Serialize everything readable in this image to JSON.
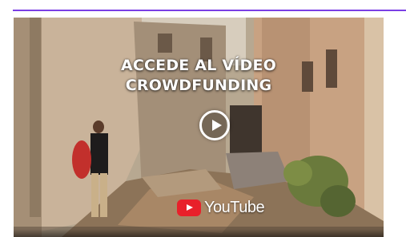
{
  "video": {
    "title_line1": "ACCEDE AL VÍDEO",
    "title_line2": "CROWDFUNDING",
    "platform": "YouTube",
    "play_icon": "play-circle-icon",
    "logo_icon": "youtube-logo-icon"
  },
  "colors": {
    "accent_rule": "#7b3fe4",
    "youtube_red": "#e8202a"
  }
}
